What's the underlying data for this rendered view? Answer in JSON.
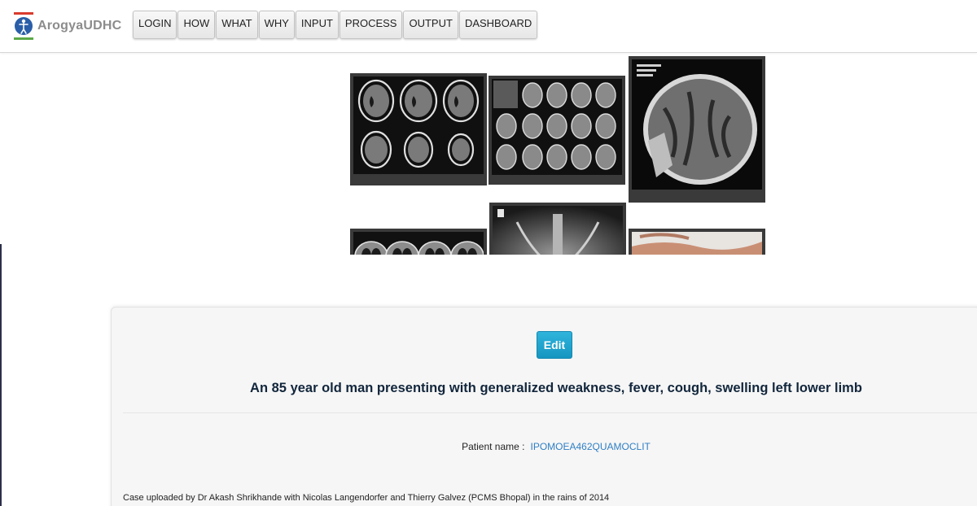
{
  "brand": {
    "name": "ArogyaUDHC",
    "logo_icon": "medical-figure-logo-icon",
    "colors": {
      "top": "#d93b2e",
      "blue": "#2a5ea8",
      "bottom": "#5aa847"
    }
  },
  "nav": {
    "items": [
      {
        "label": "LOGIN"
      },
      {
        "label": "HOW"
      },
      {
        "label": "WHAT"
      },
      {
        "label": "WHY"
      },
      {
        "label": "INPUT"
      },
      {
        "label": "PROCESS"
      },
      {
        "label": "OUTPUT"
      },
      {
        "label": "DASHBOARD"
      }
    ]
  },
  "gallery": {
    "images": [
      {
        "name": "ct-brain-axial-series"
      },
      {
        "name": "ct-brain-small-series"
      },
      {
        "name": "ct-brain-single-slice"
      },
      {
        "name": "ct-chest-lung-series"
      },
      {
        "name": "chest-xray"
      },
      {
        "name": "patient-leg-photo"
      }
    ]
  },
  "case": {
    "edit_label": "Edit",
    "title": "An 85 year old man presenting with generalized weakness, fever, cough, swelling left lower limb",
    "patient_label": "Patient name :",
    "patient_name": "IPOMOEA462QUAMOCLIT",
    "credit": "Case uploaded by Dr Akash Shrikhande with Nicolas Langendorfer and Thierry Galvez (PCMS Bhopal) in the rains of 2014"
  },
  "colors": {
    "edit_button": "#1fa5d0",
    "title_text": "#12263c",
    "link_text": "#2f7fc4"
  }
}
